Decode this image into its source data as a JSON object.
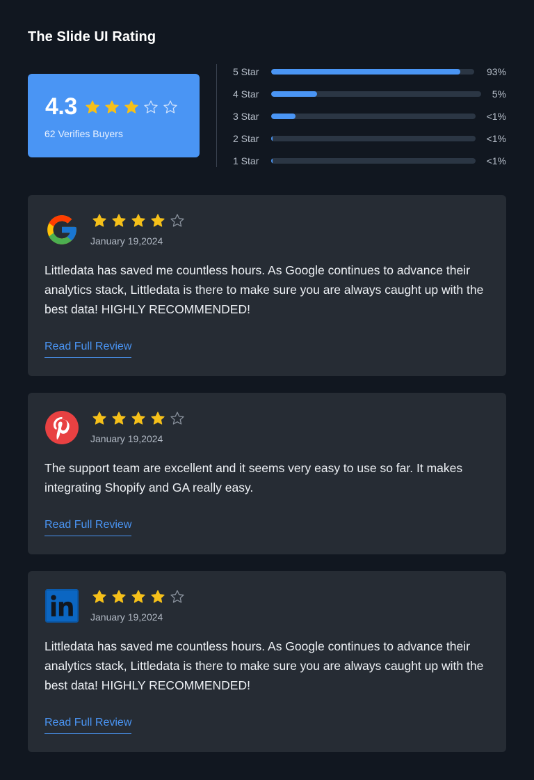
{
  "title": "The Slide UI Rating",
  "summary": {
    "score": "4.3",
    "stars_filled": 3,
    "stars_total": 5,
    "buyers_label": "62 Verifies Buyers"
  },
  "distribution": [
    {
      "label": "5 Star",
      "percent_text": "93%",
      "fill": 0.93
    },
    {
      "label": "4 Star",
      "percent_text": "5%",
      "fill": 0.22
    },
    {
      "label": "3 Star",
      "percent_text": "<1%",
      "fill": 0.12
    },
    {
      "label": "2 Star",
      "percent_text": "<1%",
      "fill": 0.008
    },
    {
      "label": "1 Star",
      "percent_text": "<1%",
      "fill": 0.008
    }
  ],
  "reviews": [
    {
      "source_icon": "google-logo-icon",
      "stars_filled": 4,
      "date": "January 19,2024",
      "text": "Littledata has saved me countless hours. As Google continues to advance their analytics stack, Littledata is there to make sure you are always caught up with the best data! HIGHLY RECOMMENDED!",
      "link_label": "Read Full Review"
    },
    {
      "source_icon": "pinterest-logo-icon",
      "stars_filled": 4,
      "date": "January 19,2024",
      "text": "The support team are excellent and it seems very easy to use so far. It makes integrating Shopify and GA really easy.",
      "link_label": "Read Full Review"
    },
    {
      "source_icon": "linkedin-logo-icon",
      "stars_filled": 4,
      "date": "January 19,2024",
      "text": "Littledata has saved me countless hours. As Google continues to advance their analytics stack, Littledata is there to make sure you are always caught up with the best data! HIGHLY RECOMMENDED!",
      "link_label": "Read Full Review"
    }
  ],
  "colors": {
    "background": "#111720",
    "accent": "#4a95f4",
    "card": "#262c34",
    "star_filled": "#f5c01a",
    "star_empty": "#8b939e",
    "star_empty_on_accent": "#cfe1fb"
  }
}
